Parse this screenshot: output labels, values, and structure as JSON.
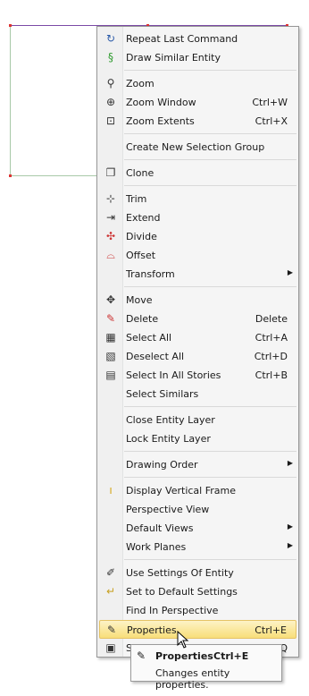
{
  "colors": {
    "highlight_top": "#fdf3c6",
    "highlight_bottom": "#f8de7a",
    "menu_bg": "#f5f5f5"
  },
  "menu": {
    "items": [
      {
        "label": "Repeat Last Command",
        "shortcut": "",
        "icon": "repeat-icon",
        "glyph": "↻"
      },
      {
        "label": "Draw Similar Entity",
        "shortcut": "",
        "icon": "draw-similar-icon",
        "glyph": "§"
      },
      {
        "label": "Zoom",
        "shortcut": "",
        "icon": "zoom-icon",
        "glyph": "⚲"
      },
      {
        "label": "Zoom Window",
        "shortcut": "Ctrl+W",
        "icon": "zoom-window-icon",
        "glyph": "⊕"
      },
      {
        "label": "Zoom Extents",
        "shortcut": "Ctrl+X",
        "icon": "zoom-extents-icon",
        "glyph": "⊡"
      },
      {
        "label": "Create New Selection Group",
        "shortcut": "",
        "icon": "",
        "glyph": ""
      },
      {
        "label": "Clone",
        "shortcut": "",
        "icon": "clone-icon",
        "glyph": "❐"
      },
      {
        "label": "Trim",
        "shortcut": "",
        "icon": "trim-icon",
        "glyph": "⊹"
      },
      {
        "label": "Extend",
        "shortcut": "",
        "icon": "extend-icon",
        "glyph": "⇥"
      },
      {
        "label": "Divide",
        "shortcut": "",
        "icon": "divide-icon",
        "glyph": "✣"
      },
      {
        "label": "Offset",
        "shortcut": "",
        "icon": "offset-icon",
        "glyph": "⌓"
      },
      {
        "label": "Transform",
        "shortcut": "",
        "icon": "",
        "glyph": ""
      },
      {
        "label": "Move",
        "shortcut": "",
        "icon": "move-icon",
        "glyph": "✥"
      },
      {
        "label": "Delete",
        "shortcut": "Delete",
        "icon": "eraser-icon",
        "glyph": "✎"
      },
      {
        "label": "Select All",
        "shortcut": "Ctrl+A",
        "icon": "select-all-icon",
        "glyph": "▦"
      },
      {
        "label": "Deselect All",
        "shortcut": "Ctrl+D",
        "icon": "deselect-all-icon",
        "glyph": "▧"
      },
      {
        "label": "Select In All Stories",
        "shortcut": "Ctrl+B",
        "icon": "select-stories-icon",
        "glyph": "▤"
      },
      {
        "label": "Select Similars",
        "shortcut": "",
        "icon": "",
        "glyph": ""
      },
      {
        "label": "Close Entity Layer",
        "shortcut": "",
        "icon": "",
        "glyph": ""
      },
      {
        "label": "Lock Entity Layer",
        "shortcut": "",
        "icon": "",
        "glyph": ""
      },
      {
        "label": "Drawing Order",
        "shortcut": "",
        "icon": "",
        "glyph": ""
      },
      {
        "label": "Display Vertical Frame",
        "shortcut": "",
        "icon": "vertical-frame-icon",
        "glyph": "ı"
      },
      {
        "label": "Perspective View",
        "shortcut": "",
        "icon": "",
        "glyph": ""
      },
      {
        "label": "Default Views",
        "shortcut": "",
        "icon": "",
        "glyph": ""
      },
      {
        "label": "Work Planes",
        "shortcut": "",
        "icon": "",
        "glyph": ""
      },
      {
        "label": "Use Settings Of Entity",
        "shortcut": "",
        "icon": "eyedropper-icon",
        "glyph": "✐"
      },
      {
        "label": "Set to Default Settings",
        "shortcut": "",
        "icon": "default-settings-icon",
        "glyph": "↵"
      },
      {
        "label": "Find In Perspective",
        "shortcut": "",
        "icon": "",
        "glyph": ""
      },
      {
        "label": "Properties",
        "shortcut": "Ctrl+E",
        "icon": "properties-icon",
        "glyph": "✎"
      },
      {
        "label": "S",
        "shortcut": "Ctrl+Q",
        "icon": "window-icon",
        "glyph": "▣"
      }
    ]
  },
  "tooltip": {
    "title": "Properties",
    "shortcut": "Ctrl+E",
    "description": "Changes entity properties."
  }
}
